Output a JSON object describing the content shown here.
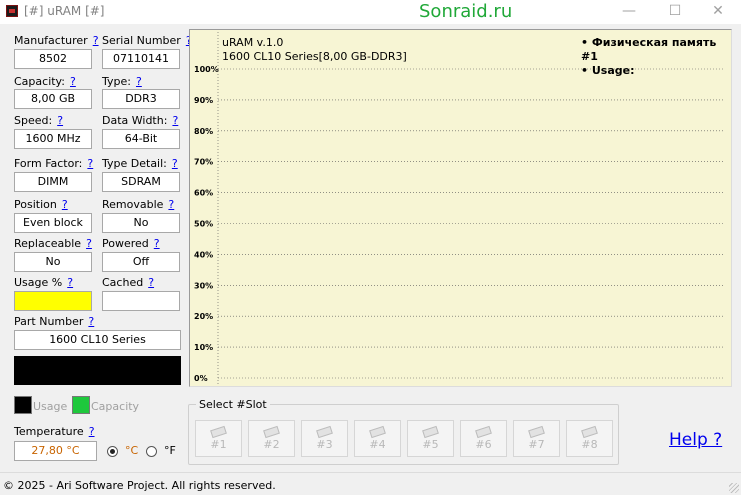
{
  "window": {
    "title": "[#] uRAM [#]",
    "watermark": "Sonraid.ru",
    "min_glyph": "—",
    "max_glyph": "☐",
    "close_glyph": "✕"
  },
  "fields": {
    "manufacturer": {
      "label": "Manufacturer",
      "help": "?",
      "value": "8502"
    },
    "serial_number": {
      "label": "Serial Number",
      "help": "?",
      "value": "07110141"
    },
    "capacity": {
      "label": "Capacity:",
      "help": "?",
      "value": "8,00 GB"
    },
    "type": {
      "label": "Type:",
      "help": "?",
      "value": "DDR3"
    },
    "speed": {
      "label": "Speed:",
      "help": "?",
      "value": "1600 MHz"
    },
    "data_width": {
      "label": "Data Width:",
      "help": "?",
      "value": "64-Bit"
    },
    "form_factor": {
      "label": "Form Factor:",
      "help": "?",
      "value": "DIMM"
    },
    "type_detail": {
      "label": "Type Detail:",
      "help": "?",
      "value": "SDRAM"
    },
    "position": {
      "label": "Position",
      "help": "?",
      "value": "Even block"
    },
    "removable": {
      "label": "Removable",
      "help": "?",
      "value": "No"
    },
    "replaceable": {
      "label": "Replaceable",
      "help": "?",
      "value": "No"
    },
    "powered": {
      "label": "Powered",
      "help": "?",
      "value": "Off"
    },
    "usage": {
      "label": "Usage %",
      "help": "?",
      "value": ""
    },
    "cached": {
      "label": "Cached",
      "help": "?",
      "value": ""
    },
    "part_number": {
      "label": "Part Number",
      "help": "?",
      "value": "1600 CL10 Series"
    }
  },
  "colors": {
    "usage_fill": "#ffff00",
    "usage_swatch": "#000000",
    "capacity_swatch": "#1ec83c",
    "chart_bg": "#f7f5d4",
    "link": "#0000ee"
  },
  "legend": {
    "usage": "Usage",
    "capacity": "Capacity"
  },
  "chart_info": {
    "version": "uRAM v.1.0",
    "module": "1600 CL10 Series[8,00 GB-DDR3]",
    "memory_label": "• Физическая память #1",
    "usage_label": "• Usage:"
  },
  "chart_data": {
    "type": "line",
    "title": "uRAM v.1.0",
    "ylim": [
      0,
      100
    ],
    "y_ticks": [
      "100%",
      "90%",
      "80%",
      "70%",
      "60%",
      "50%",
      "40%",
      "30%",
      "20%",
      "10%",
      "0%"
    ],
    "grid": true,
    "series": []
  },
  "temperature": {
    "label": "Temperature",
    "help": "?",
    "value": "27,80 °C",
    "unit_c": "°C",
    "unit_f": "°F",
    "selected": "C"
  },
  "slots": {
    "title": "Select #Slot",
    "items": [
      "#1",
      "#2",
      "#3",
      "#4",
      "#5",
      "#6",
      "#7",
      "#8"
    ]
  },
  "help_link": "Help ?",
  "footer": "© 2025 - Ari Software Project. All rights reserved."
}
